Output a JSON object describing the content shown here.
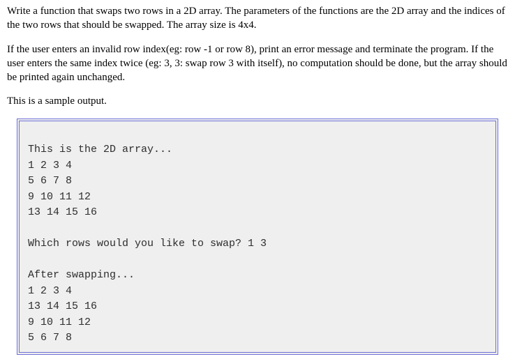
{
  "para1": "Write a function that swaps two rows in a 2D array. The parameters of the functions are the 2D array and the indices of the two rows that should be swapped. The array size is 4x4.",
  "para2": "If the user enters an invalid row index(eg: row -1 or row 8), print an error message and terminate the program. If the user enters the same index twice (eg: 3, 3: swap row 3 with itself), no computation should be done, but the array should be printed again unchanged.",
  "para3": "This is a sample output.",
  "output": {
    "header": "This is the 2D array...",
    "r0": "1 2 3 4",
    "r1": "5 6 7 8",
    "r2": "9 10 11 12",
    "r3": "13 14 15 16",
    "prompt": "Which rows would you like to swap? 1 3",
    "after": "After swapping...",
    "a0": "1 2 3 4",
    "a1": "13 14 15 16",
    "a2": "9 10 11 12",
    "a3": "5 6 7 8"
  },
  "chart_data": {
    "type": "table",
    "title": "4x4 2D array before and after swapping rows 1 and 3",
    "before": [
      [
        1,
        2,
        3,
        4
      ],
      [
        5,
        6,
        7,
        8
      ],
      [
        9,
        10,
        11,
        12
      ],
      [
        13,
        14,
        15,
        16
      ]
    ],
    "swap_indices": [
      1,
      3
    ],
    "after": [
      [
        1,
        2,
        3,
        4
      ],
      [
        13,
        14,
        15,
        16
      ],
      [
        9,
        10,
        11,
        12
      ],
      [
        5,
        6,
        7,
        8
      ]
    ]
  }
}
